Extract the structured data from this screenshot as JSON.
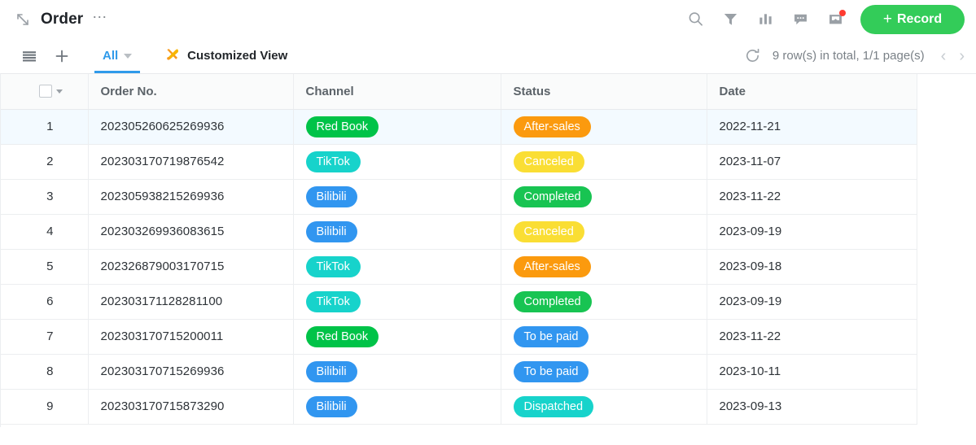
{
  "titlebar": {
    "expand_icon": "expand-arrows-icon",
    "title": "Order",
    "more_icon": "more-dots-icon",
    "tools": [
      {
        "name": "search-icon",
        "label": "Search"
      },
      {
        "name": "filter-icon",
        "label": "Filter"
      },
      {
        "name": "chart-icon",
        "label": "Statistics"
      },
      {
        "name": "comment-icon",
        "label": "Comments"
      },
      {
        "name": "inbox-icon",
        "label": "Notifications",
        "badge": true
      }
    ],
    "record_button": {
      "plus": "+",
      "label": "Record"
    }
  },
  "subbar": {
    "list_icon": "list-view-icon",
    "add_icon": "plus-icon",
    "tab_all": "All",
    "customized_view_icon": "tools-icon",
    "customized_view": "Customized View",
    "refresh_icon": "refresh-icon",
    "row_count": "9 row(s) in total, 1/1 page(s)",
    "prev_page": "‹",
    "next_page": "›"
  },
  "table": {
    "columns": [
      "Order No.",
      "Channel",
      "Status",
      "Date"
    ],
    "rows": [
      {
        "n": "1",
        "order": "202305260625269936",
        "channel": "Red Book",
        "channel_color": "#00c348",
        "status": "After-sales",
        "status_color": "#fb9a0e",
        "date": "2022-11-21",
        "highlight": true
      },
      {
        "n": "2",
        "order": "202303170719876542",
        "channel": "TikTok",
        "channel_color": "#17d3cb",
        "status": "Canceled",
        "status_color": "#fade34",
        "date": "2023-11-07",
        "highlight": false
      },
      {
        "n": "3",
        "order": "202305938215269936",
        "channel": "Bilibili",
        "channel_color": "#3196f0",
        "status": "Completed",
        "status_color": "#18c452",
        "date": "2023-11-22",
        "highlight": false
      },
      {
        "n": "4",
        "order": "202303269936083615",
        "channel": "Bilibili",
        "channel_color": "#3196f0",
        "status": "Canceled",
        "status_color": "#fade34",
        "date": "2023-09-19",
        "highlight": false
      },
      {
        "n": "5",
        "order": "202326879003170715",
        "channel": "TikTok",
        "channel_color": "#17d3cb",
        "status": "After-sales",
        "status_color": "#fb9a0e",
        "date": "2023-09-18",
        "highlight": false
      },
      {
        "n": "6",
        "order": "202303171128281100",
        "channel": "TikTok",
        "channel_color": "#17d3cb",
        "status": "Completed",
        "status_color": "#18c452",
        "date": "2023-09-19",
        "highlight": false
      },
      {
        "n": "7",
        "order": "202303170715200011",
        "channel": "Red Book",
        "channel_color": "#00c348",
        "status": "To be paid",
        "status_color": "#3196f0",
        "date": "2023-11-22",
        "highlight": false
      },
      {
        "n": "8",
        "order": "202303170715269936",
        "channel": "Bilibili",
        "channel_color": "#3196f0",
        "status": "To be paid",
        "status_color": "#3196f0",
        "date": "2023-10-11",
        "highlight": false
      },
      {
        "n": "9",
        "order": "202303170715873290",
        "channel": "Bilibili",
        "channel_color": "#3196f0",
        "status": "Dispatched",
        "status_color": "#17d3cb",
        "date": "2023-09-13",
        "highlight": false
      }
    ]
  },
  "colors": {
    "accent_blue": "#2f9aea",
    "record_green": "#33cc59",
    "row_highlight": "#f3faff",
    "header_bg": "#fafbfb"
  }
}
